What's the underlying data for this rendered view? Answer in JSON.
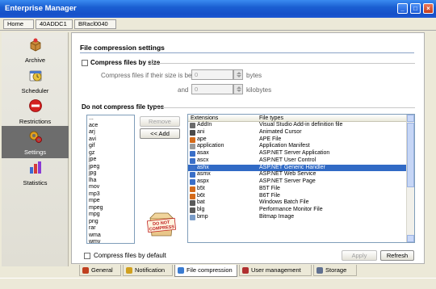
{
  "window": {
    "title": "Enterprise Manager"
  },
  "breadcrumb": [
    "Home",
    "40ADDC1",
    "BRacl0040"
  ],
  "sidebar": {
    "items": [
      {
        "label": "Archive",
        "icon": "archive-box-icon",
        "active": false
      },
      {
        "label": "Scheduler",
        "icon": "scheduler-clock-icon",
        "active": false
      },
      {
        "label": "Restrictions",
        "icon": "no-entry-icon",
        "active": false
      },
      {
        "label": "Settings",
        "icon": "settings-gear-icon",
        "active": true
      },
      {
        "label": "Statistics",
        "icon": "statistics-chart-icon",
        "active": false
      }
    ]
  },
  "page": {
    "title": "File compression settings",
    "compress_by_size": {
      "label": "Compress files by size",
      "checked": false,
      "between_label": "Compress files if their size is between",
      "from_value": "0",
      "from_unit": "bytes",
      "and_label": "and",
      "to_value": "0",
      "to_unit": "kilobytes"
    },
    "exclusions": {
      "title": "Do not compress file types",
      "excluded": [
        "...",
        "ace",
        "arj",
        "avi",
        "gif",
        "gz",
        "jpe",
        "jpeg",
        "jpg",
        "lha",
        "mov",
        "mp3",
        "mpe",
        "mpeg",
        "mpg",
        "png",
        "rar",
        "wma",
        "wmv"
      ],
      "remove_label": "Remove",
      "add_label": "<< Add",
      "badge_text_1": "DO NOT",
      "badge_text_2": "COMPRESS",
      "columns": [
        "Extensions",
        "File types"
      ],
      "rows": [
        {
          "ext": "AddIn",
          "type": "Visual Studio Add-in definition file",
          "color": "#6b6b6b"
        },
        {
          "ext": "ani",
          "type": "Animated Cursor",
          "color": "#4a4a4a"
        },
        {
          "ext": "ape",
          "type": "APE File",
          "color": "#d46a1a"
        },
        {
          "ext": "application",
          "type": "Application Manifest",
          "color": "#9a9a9a"
        },
        {
          "ext": "asax",
          "type": "ASP.NET Server Application",
          "color": "#3a6fc8"
        },
        {
          "ext": "ascx",
          "type": "ASP.NET User Control",
          "color": "#3a6fc8"
        },
        {
          "ext": "ashx",
          "type": "ASP.NET Generic Handler",
          "color": "#3a6fc8",
          "selected": true
        },
        {
          "ext": "asmx",
          "type": "ASP.NET Web Service",
          "color": "#3a6fc8"
        },
        {
          "ext": "aspx",
          "type": "ASP.NET Server Page",
          "color": "#3a6fc8"
        },
        {
          "ext": "b5t",
          "type": "B5T File",
          "color": "#d46a1a"
        },
        {
          "ext": "b6t",
          "type": "B6T File",
          "color": "#d46a1a"
        },
        {
          "ext": "bat",
          "type": "Windows Batch File",
          "color": "#5a5a5a"
        },
        {
          "ext": "blg",
          "type": "Performance Monitor File",
          "color": "#5a5a5a"
        },
        {
          "ext": "bmp",
          "type": "Bitmap Image",
          "color": "#7a9cc8"
        }
      ]
    },
    "compress_by_default": {
      "label": "Compress files by default",
      "checked": false
    },
    "apply_label": "Apply",
    "refresh_label": "Refresh"
  },
  "tabs": [
    {
      "label": "General",
      "icon": "general-icon",
      "color": "#c04020",
      "active": false
    },
    {
      "label": "Notification",
      "icon": "notification-icon",
      "color": "#d0a020",
      "active": false
    },
    {
      "label": "File compression",
      "icon": "file-compression-icon",
      "color": "#3a7bd0",
      "active": true
    },
    {
      "label": "User management",
      "icon": "user-management-icon",
      "color": "#b03030",
      "active": false
    },
    {
      "label": "Storage",
      "icon": "storage-icon",
      "color": "#607090",
      "active": false
    }
  ]
}
